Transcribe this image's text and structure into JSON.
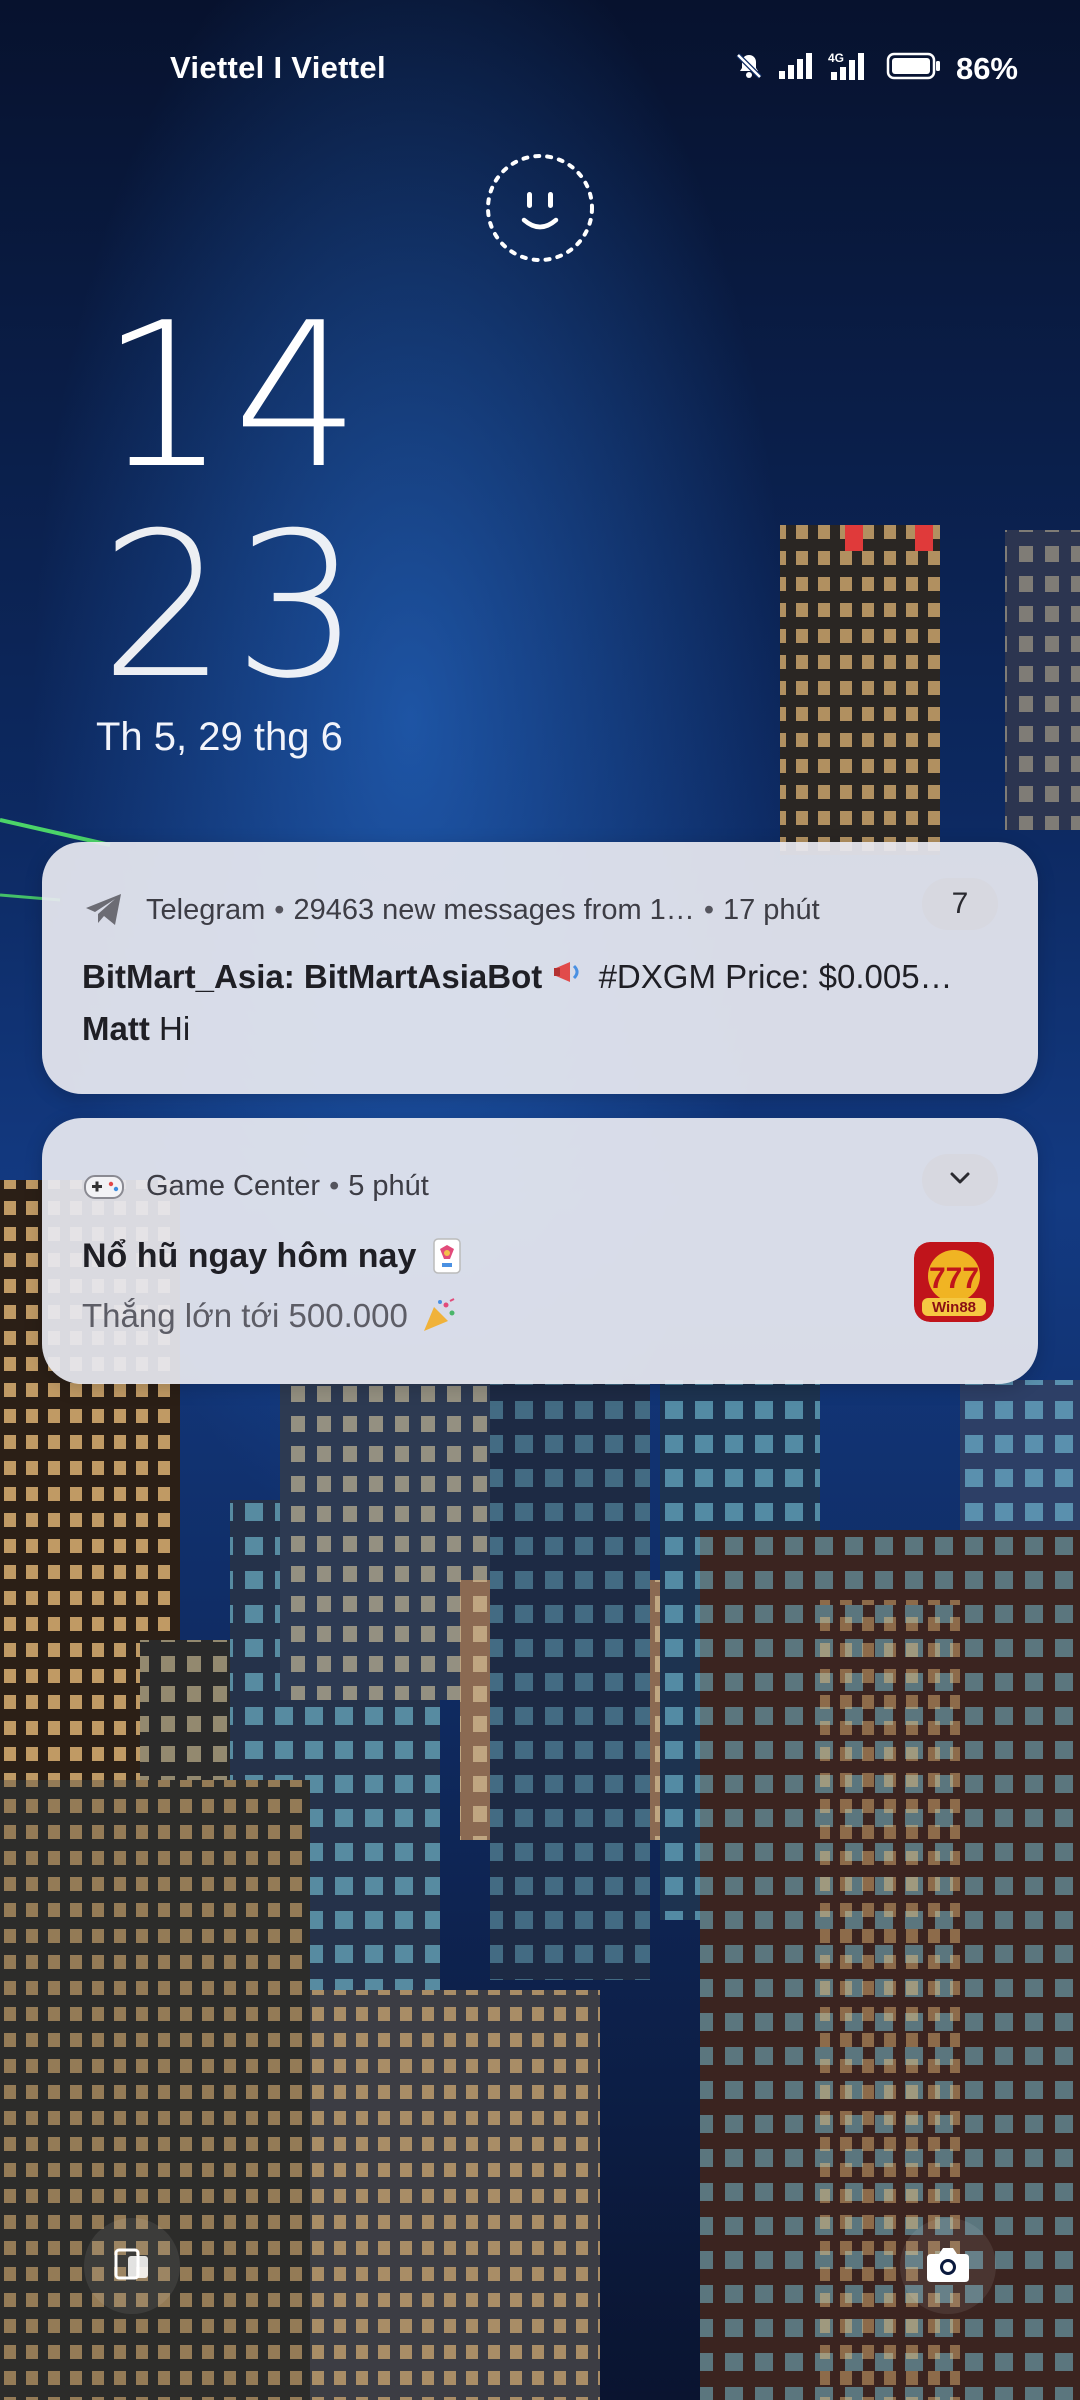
{
  "status_bar": {
    "carrier": "Viettel I Viettel",
    "battery_percent": "86%",
    "network_type": "4G",
    "icons": [
      "mute-bell-icon",
      "signal-icon",
      "signal-4g-icon",
      "battery-icon"
    ]
  },
  "lock_screen": {
    "hour": "14",
    "minute": "23",
    "date": "Th 5, 29 thg 6"
  },
  "notifications": [
    {
      "app": "Telegram",
      "summary": "29463 new messages from 1…",
      "time": "17 phút",
      "count": "7",
      "lines": [
        {
          "sender": "BitMart_Asia: BitMartAsiaBot",
          "text": "#DXGM Price: $0.005…"
        },
        {
          "sender": "Matt",
          "text": "Hi"
        }
      ]
    },
    {
      "app": "Game Center",
      "time": "5 phút",
      "title": "Nổ hũ ngay hôm nay",
      "body": "Thắng lớn tới 500.000",
      "thumbnail_text": "Win88"
    }
  ],
  "colors": {
    "card_background": "#e7e8f0",
    "sky_top": "#0b1a3e",
    "sky_glow": "#1f5fbf",
    "text_dark": "#1f1f25"
  }
}
